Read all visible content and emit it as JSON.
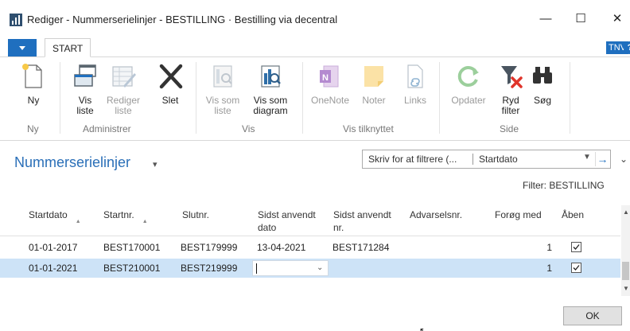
{
  "window": {
    "title": "Rediger - Nummerserielinjer - BESTILLING · Bestilling via decentral",
    "minimize": "—",
    "maximize": "☐",
    "close": "✕"
  },
  "ribbon_tabs": {
    "start": "START",
    "user_badge": "TNV",
    "help": "?"
  },
  "ribbon": {
    "groups": {
      "ny": "Ny",
      "administrer": "Administrer",
      "vis": "Vis",
      "vis_tilknyttet": "Vis tilknyttet",
      "side": "Side"
    },
    "buttons": {
      "ny": "Ny",
      "vis_liste": "Vis\nliste",
      "rediger_liste": "Rediger\nliste",
      "slet": "Slet",
      "vis_som_liste": "Vis som\nliste",
      "vis_som_diagram": "Vis som\ndiagram",
      "onenote": "OneNote",
      "noter": "Noter",
      "links": "Links",
      "opdater": "Opdater",
      "ryd_filter": "Ryd\nfilter",
      "sog": "Søg"
    }
  },
  "page": {
    "title": "Nummerserielinjer",
    "filter_placeholder": "Skriv for at filtrere (...",
    "filter_field": "Startdato",
    "filter_summary": "Filter: BESTILLING"
  },
  "table": {
    "columns": [
      "Startdato",
      "Startnr.",
      "Slutnr.",
      "Sidst anvendt\ndato",
      "Sidst anvendt\nnr.",
      "Advarselsnr.",
      "Forøg med",
      "Åben"
    ],
    "rows": [
      {
        "startdato": "01-01-2017",
        "startnr": "BEST170001",
        "slutnr": "BEST179999",
        "sidst_dato": "13-04-2021",
        "sidst_nr": "BEST171284",
        "advarselsnr": "",
        "forog_med": "1",
        "aben": true
      },
      {
        "startdato": "01-01-2021",
        "startnr": "BEST210001",
        "slutnr": "BEST219999",
        "sidst_dato": "",
        "sidst_nr": "",
        "advarselsnr": "",
        "forog_med": "1",
        "aben": true
      }
    ]
  },
  "footer": {
    "ok": "OK"
  },
  "colors": {
    "accent": "#1f6fbf",
    "title_blue": "#2a6fb8",
    "selected_row": "#cde3f7"
  }
}
